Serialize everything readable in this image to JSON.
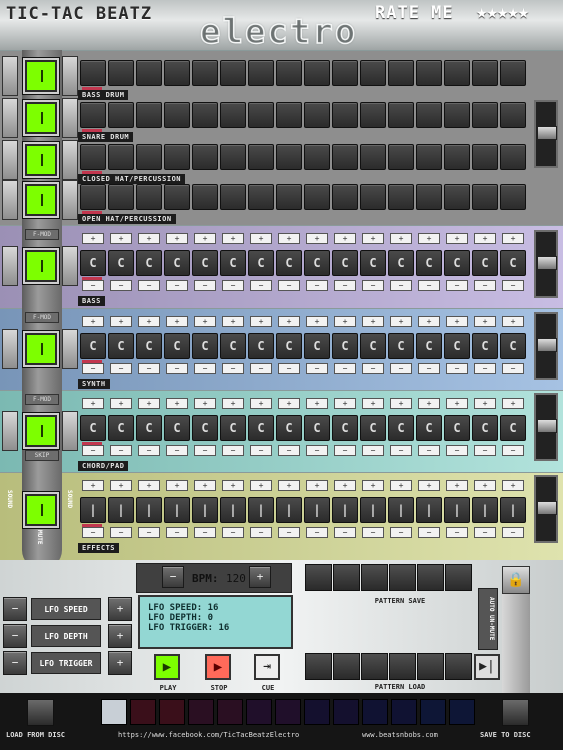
{
  "header": {
    "app_title": "TIC-TAC BEATZ",
    "preset_name": "electro",
    "rate_label": "RATE ME",
    "stars": "★★★★★"
  },
  "tracks": {
    "bass_drum": "BASS DRUM",
    "snare_drum": "SNARE DRUM",
    "closed_hat": "CLOSED HAT/PERCUSSION",
    "open_hat": "OPEN HAT/PERCUSSION",
    "bass": "BASS",
    "synth": "SYNTH",
    "chord_pad": "CHORD/PAD",
    "effects": "EFFECTS"
  },
  "note_glyph": "C",
  "plus_glyph": "+",
  "minus_glyph": "−",
  "fmod_label": "F-MOD",
  "skip_label": "SKIP",
  "sound_label": "SOUND",
  "mute_label": "MUTE",
  "bpm": {
    "label": "BPM:",
    "value": "120"
  },
  "lfo": {
    "speed_label": "LFO SPEED",
    "depth_label": "LFO DEPTH",
    "trigger_label": "LFO TRIGGER",
    "display": {
      "speed": "LFO SPEED: 16",
      "depth": "LFO DEPTH: 0",
      "trigger": "LFO TRIGGER: 16"
    }
  },
  "transport": {
    "play": "PLAY",
    "stop": "STOP",
    "cue": "CUE"
  },
  "pattern": {
    "save": "PATTERN SAVE",
    "load": "PATTERN LOAD",
    "auto_unmute": "AUTO UN-MUTE"
  },
  "footer": {
    "load_disc": "LOAD FROM DISC",
    "save_disc": "SAVE TO DISC",
    "facebook": "https://www.facebook.com/TicTacBeatzElectro",
    "site": "www.beatsnbobs.com"
  },
  "colors": {
    "pad_green": "#7dff00",
    "band_purple": "#b8a9d6",
    "band_blue": "#8fb1d6",
    "band_cyan": "#97d3cd",
    "band_yellow": "#cfd596",
    "accent_red": "#c2364e"
  }
}
